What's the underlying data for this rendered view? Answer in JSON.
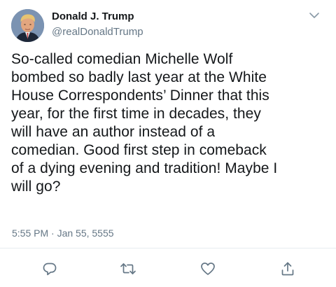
{
  "tweet": {
    "author": {
      "display_name": "Donald J. Trump",
      "handle": "@realDonaldTrump",
      "avatar_icon": "profile-photo"
    },
    "text": "So-called comedian Michelle Wolf\nbombed so badly last year at the White\nHouse Correspondents’ Dinner that this\nyear, for the first time in decades, they\nwill have an author instead of a\ncomedian. Good first step in comeback\nof a dying evening and tradition! Maybe I\nwill go?",
    "timestamp": "5:55 PM · Jan 55, 5555",
    "menu_icon": "chevron-down-icon",
    "actions": [
      {
        "name": "reply",
        "icon": "reply-icon"
      },
      {
        "name": "retweet",
        "icon": "retweet-icon"
      },
      {
        "name": "like",
        "icon": "heart-icon"
      },
      {
        "name": "share",
        "icon": "share-icon"
      }
    ]
  },
  "colors": {
    "text": "#14171a",
    "secondary": "#657786",
    "icon": "#657786",
    "divider": "#e6ecf0"
  }
}
